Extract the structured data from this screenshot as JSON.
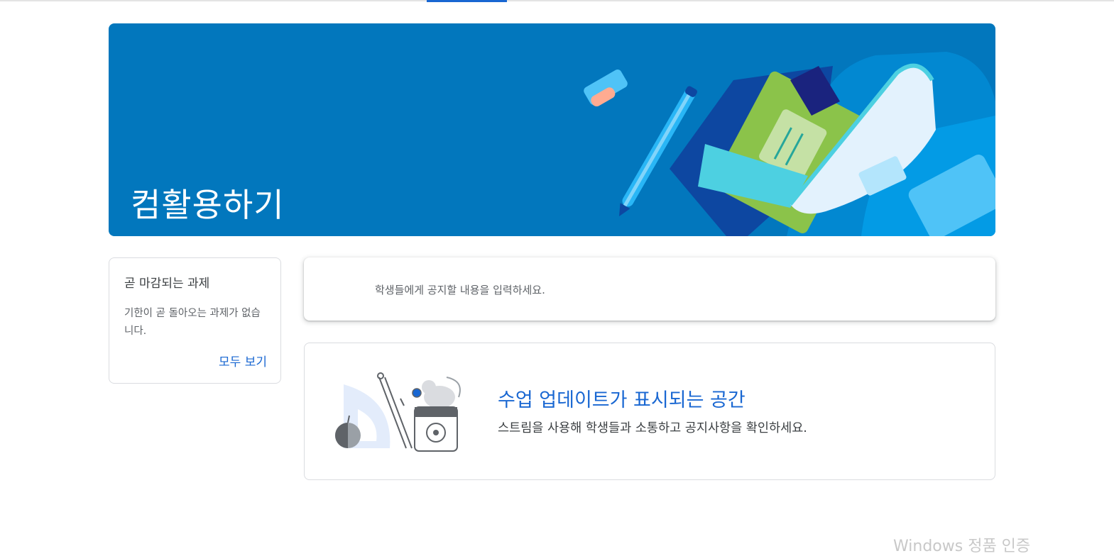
{
  "banner": {
    "class_name": "컴활용하기",
    "background_color": "#0277bd"
  },
  "upcoming": {
    "title": "곧 마감되는 과제",
    "empty_text": "기한이 곧 돌아오는 과제가 없습니다.",
    "view_all_label": "모두 보기"
  },
  "announcement": {
    "placeholder": "학생들에게 공지할 내용을 입력하세요."
  },
  "stream_empty": {
    "heading": "수업 업데이트가 표시되는 공간",
    "description": "스트림을 사용해 학생들과 소통하고 공지사항을 확인하세요."
  },
  "watermark": {
    "text": "Windows 정품 인증"
  },
  "colors": {
    "accent": "#1967d2",
    "border": "#dadce0"
  }
}
